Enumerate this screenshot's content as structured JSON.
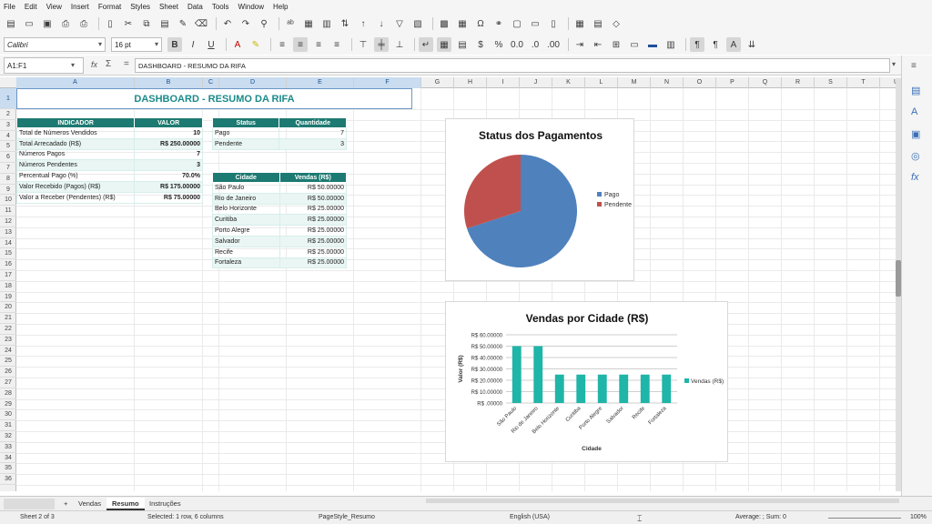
{
  "menu": [
    "File",
    "Edit",
    "View",
    "Insert",
    "Format",
    "Styles",
    "Sheet",
    "Data",
    "Tools",
    "Window",
    "Help"
  ],
  "toolbar": {
    "font_name": "Calibri",
    "font_size": "16 pt",
    "icons": [
      "new-icon",
      "open-icon",
      "save-icon",
      "export-pdf-icon",
      "print-icon",
      "print-preview-icon",
      "cut-icon",
      "copy-icon",
      "paste-icon",
      "clone-icon",
      "clear-icon",
      "undo-icon",
      "redo-icon",
      "find-icon",
      "spellcheck-icon",
      "row-icon",
      "column-icon",
      "sort-icon",
      "sort-asc-icon",
      "sort-desc-icon",
      "autofilter-icon",
      "image-icon",
      "chart-icon",
      "pivot-icon",
      "special-char-icon",
      "hyperlink-icon",
      "comment-icon",
      "header-footer-icon",
      "define-print-area-icon",
      "freeze-icon",
      "split-icon",
      "show-draw-icon"
    ]
  },
  "formula_bar": {
    "name_box": "A1:F1",
    "fx": "fx",
    "sigma": "Σ",
    "equals": "=",
    "content": "DASHBOARD - RESUMO DA RIFA"
  },
  "columns": [
    "A",
    "B",
    "C",
    "D",
    "E",
    "F",
    "G",
    "H",
    "I",
    "J",
    "K",
    "L",
    "M",
    "N",
    "O",
    "P",
    "Q",
    "R",
    "S",
    "T",
    "U"
  ],
  "rows": [
    "1",
    "2",
    "3",
    "4",
    "5",
    "6",
    "7",
    "8",
    "9",
    "10",
    "11",
    "12",
    "13",
    "14",
    "15",
    "16",
    "17",
    "18",
    "19",
    "20",
    "21",
    "22",
    "23",
    "24",
    "25",
    "26",
    "27",
    "28",
    "29",
    "30",
    "31",
    "32",
    "33",
    "34",
    "35",
    "36"
  ],
  "title": "DASHBOARD - RESUMO DA RIFA",
  "indicator_table": {
    "headers": [
      "INDICADOR",
      "VALOR"
    ],
    "rows": [
      [
        "Total de Números Vendidos",
        "10"
      ],
      [
        "Total Arrecadado (R$)",
        "R$ 250.00000"
      ],
      [
        "Números Pagos",
        "7"
      ],
      [
        "Números Pendentes",
        "3"
      ],
      [
        "Percentual Pago (%)",
        "70.0%"
      ],
      [
        "Valor Recebido (Pagos) (R$)",
        "R$ 175.00000"
      ],
      [
        "Valor a Receber (Pendentes) (R$)",
        "R$ 75.00000"
      ]
    ]
  },
  "status_table": {
    "headers": [
      "Status",
      "Quantidade"
    ],
    "rows": [
      [
        "Pago",
        "7"
      ],
      [
        "Pendente",
        "3"
      ]
    ]
  },
  "city_table": {
    "headers": [
      "Cidade",
      "Vendas (R$)"
    ],
    "rows": [
      [
        "São Paulo",
        "R$ 50.00000"
      ],
      [
        "Rio de Janeiro",
        "R$ 50.00000"
      ],
      [
        "Belo Horizonte",
        "R$ 25.00000"
      ],
      [
        "Curitiba",
        "R$ 25.00000"
      ],
      [
        "Porto Alegre",
        "R$ 25.00000"
      ],
      [
        "Salvador",
        "R$ 25.00000"
      ],
      [
        "Recife",
        "R$ 25.00000"
      ],
      [
        "Fortaleza",
        "R$ 25.00000"
      ]
    ]
  },
  "chart_data": [
    {
      "type": "pie",
      "title": "Status dos Pagamentos",
      "categories": [
        "Pago",
        "Pendente"
      ],
      "values": [
        7,
        3
      ],
      "colors": [
        "#4f81bd",
        "#c0504d"
      ],
      "legend": "right"
    },
    {
      "type": "bar",
      "title": "Vendas por Cidade (R$)",
      "categories": [
        "São Paulo",
        "Rio de Janeiro",
        "Belo Horizonte",
        "Curitiba",
        "Porto Alegre",
        "Salvador",
        "Recife",
        "Fortaleza"
      ],
      "series": [
        {
          "name": "Vendas (R$)",
          "values": [
            50,
            50,
            25,
            25,
            25,
            25,
            25,
            25
          ]
        }
      ],
      "xlabel": "Cidade",
      "ylabel": "Valor (R$)",
      "ylim": [
        0,
        60
      ],
      "yticks": [
        "R$ .00000",
        "R$ 10.00000",
        "R$ 20.00000",
        "R$ 30.00000",
        "R$ 40.00000",
        "R$ 50.00000",
        "R$ 60.00000"
      ],
      "color": "#1fb5a8",
      "grid": true,
      "legend": "right"
    }
  ],
  "tabs": {
    "add": "+",
    "items": [
      "Vendas",
      "Resumo",
      "Instruções"
    ],
    "active": "Resumo"
  },
  "statusbar": {
    "sheet": "Sheet 2 of 3",
    "selection": "Selected: 1 row, 6 columns",
    "page_style": "PageStyle_Resumo",
    "language": "English (USA)",
    "summary": "Average: ; Sum: 0",
    "zoom": "100%"
  }
}
